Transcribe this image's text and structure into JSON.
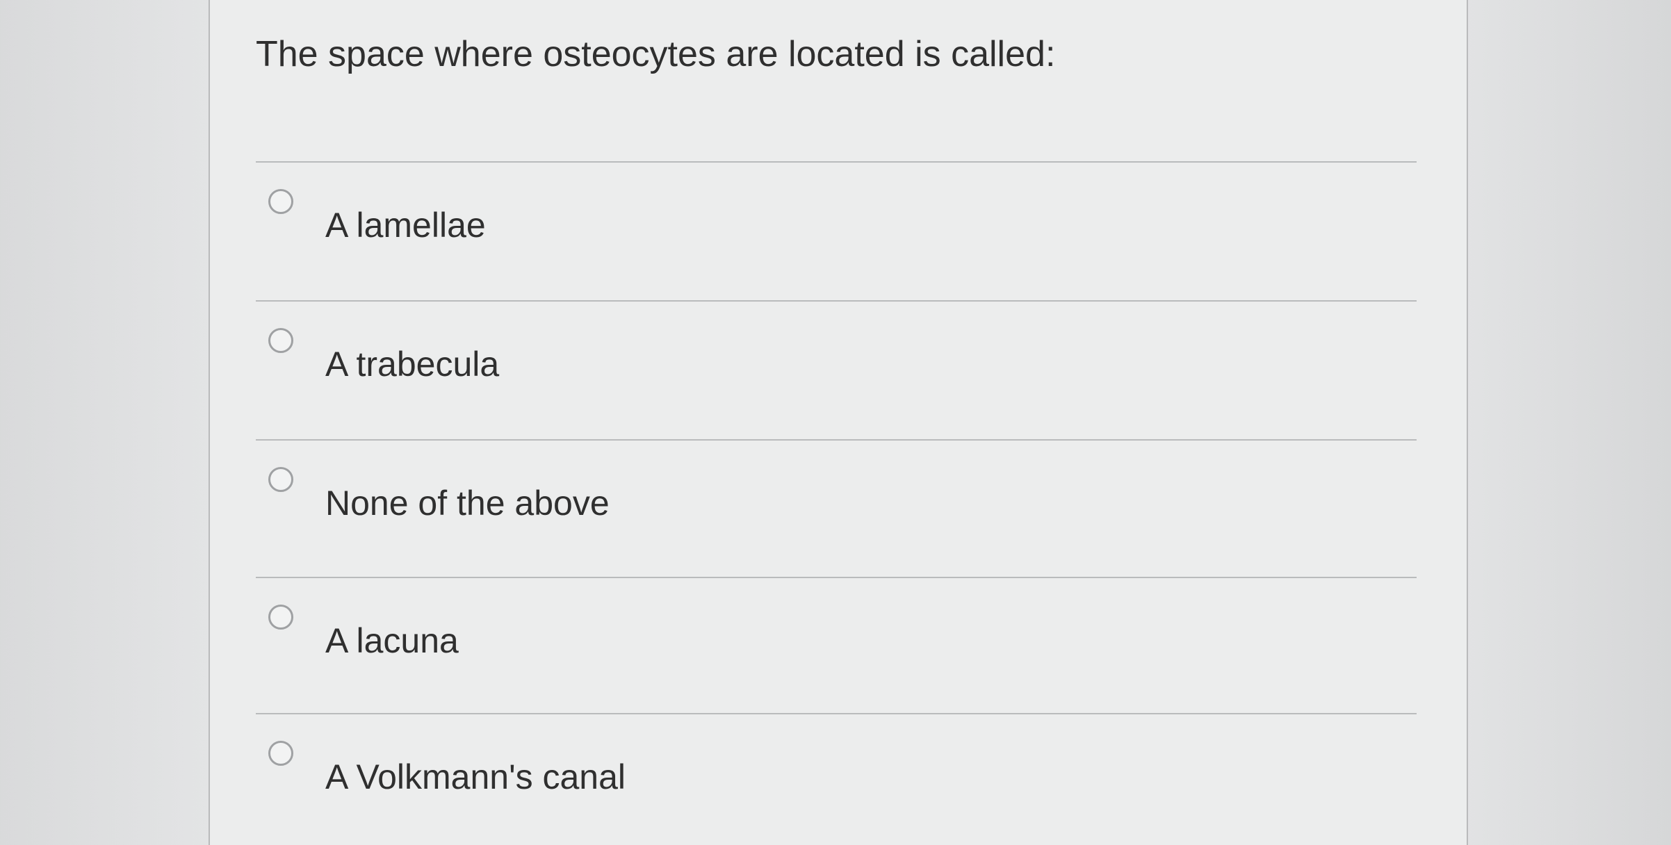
{
  "question": {
    "text": "The space where osteocytes are located is called:"
  },
  "options": [
    {
      "label": "A lamellae",
      "selected": false,
      "icon": "radio-unchecked-icon"
    },
    {
      "label": "A trabecula",
      "selected": false,
      "icon": "radio-unchecked-icon"
    },
    {
      "label": "None of the above",
      "selected": false,
      "icon": "radio-unchecked-icon"
    },
    {
      "label": "A lacuna",
      "selected": false,
      "icon": "radio-unchecked-icon"
    },
    {
      "label": "A Volkmann's canal",
      "selected": false,
      "icon": "radio-unchecked-icon"
    }
  ]
}
